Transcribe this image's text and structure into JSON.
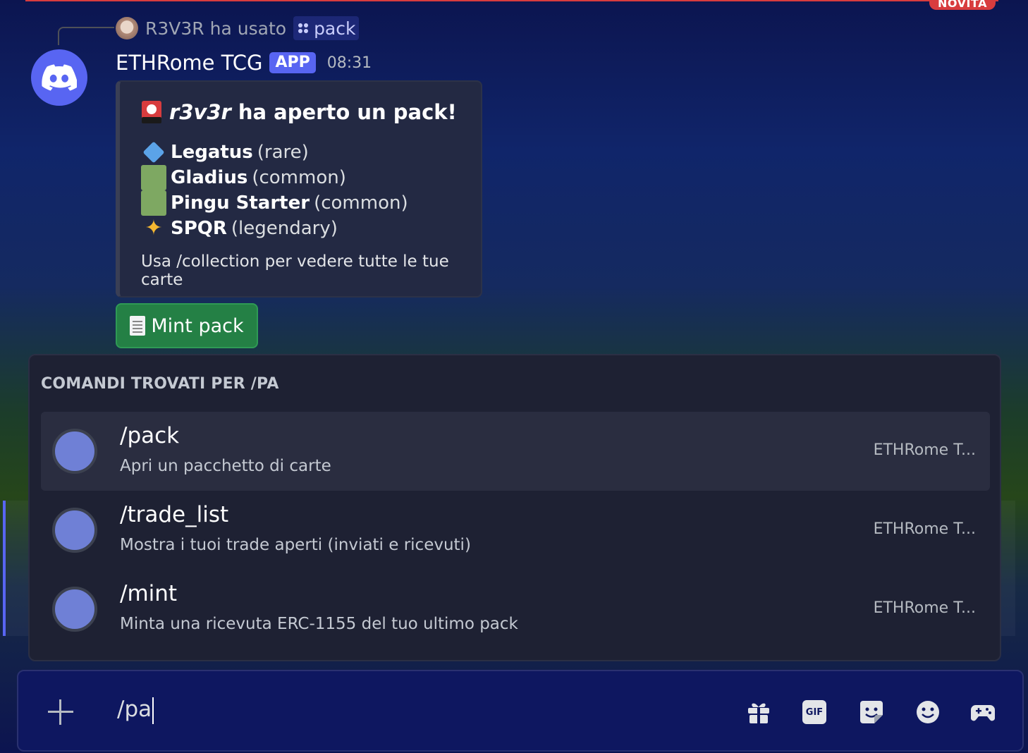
{
  "banner": {
    "badge": "NOVITÀ"
  },
  "reply": {
    "user": "R3V3R",
    "action": "ha usato",
    "command": "pack"
  },
  "message": {
    "bot_name": "ETHRome TCG",
    "badge": "APP",
    "time": "08:31",
    "embed": {
      "title_user": "r3v3r",
      "title_rest": "ha aperto un pack!",
      "cards": [
        {
          "name": "Legatus",
          "rarity": "(rare)",
          "icon": "blue-diamond-icon"
        },
        {
          "name": "Gladius",
          "rarity": "(common)",
          "icon": "green-square-icon"
        },
        {
          "name": "Pingu Starter",
          "rarity": "(common)",
          "icon": "green-square-icon"
        },
        {
          "name": "SPQR",
          "rarity": "(legendary)",
          "icon": "sparkles-icon"
        }
      ],
      "footer": "Usa /collection per vedere tutte le tue carte"
    },
    "button": {
      "label": "Mint pack",
      "icon": "receipt-icon"
    }
  },
  "autocomplete": {
    "title": "COMANDI TROVATI PER /PA",
    "items": [
      {
        "name": "/pack",
        "desc": "Apri un pacchetto di carte",
        "app": "ETHRome T..."
      },
      {
        "name": "/trade_list",
        "desc": "Mostra i tuoi trade aperti (inviati e ricevuti)",
        "app": "ETHRome T..."
      },
      {
        "name": "/mint",
        "desc": "Minta una ricevuta ERC-1155 del tuo ultimo pack",
        "app": "ETHRome T..."
      }
    ]
  },
  "composer": {
    "value": "/pa",
    "tools": [
      "gift-icon",
      "gif-icon",
      "sticker-icon",
      "emoji-icon",
      "gamepad-icon"
    ],
    "gif_label": "GIF"
  },
  "colors": {
    "accent": "#5865f2",
    "button_green": "#248045",
    "alert_red": "#d83c3e"
  }
}
